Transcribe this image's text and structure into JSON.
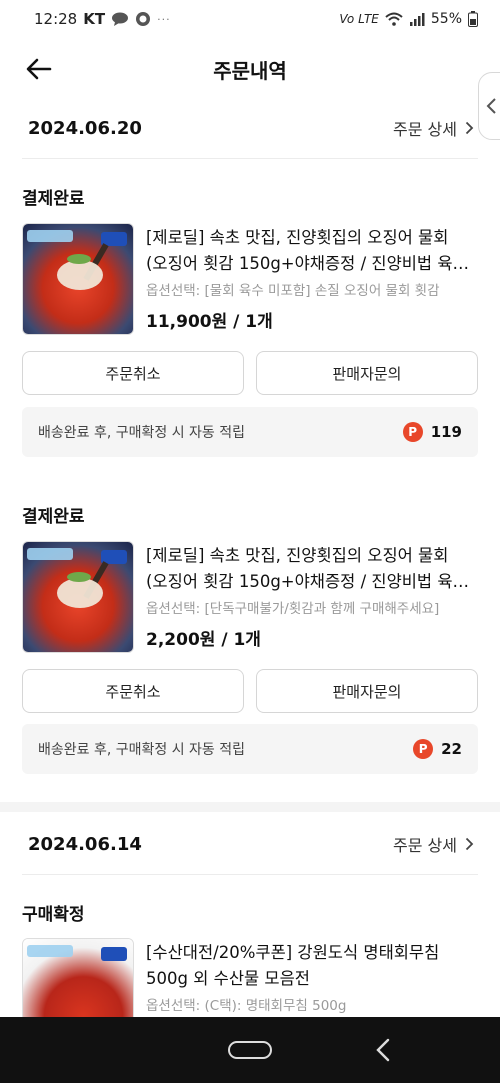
{
  "status_bar": {
    "time": "12:28",
    "carrier": "KT",
    "overflow": "···",
    "network": "Vo LTE",
    "battery": "55%"
  },
  "header": {
    "title": "주문내역"
  },
  "orders": [
    {
      "date": "2024.06.20",
      "detail_label": "주문 상세",
      "items": [
        {
          "status": "결제완료",
          "name": "[제로딜] 속초 맛집, 진양횟집의 오징어 물회(오징어 횟감 150g+야채증정 / 진양비법 육수 제공)",
          "option": "옵션선택: [물회 육수 미포함] 손질 오징어 물회 횟감",
          "price": "11,900원 / 1개",
          "cancel_label": "주문취소",
          "inquiry_label": "판매자문의",
          "point_msg": "배송완료 후, 구매확정 시 자동 적립",
          "point_icon": "P",
          "points": "119"
        },
        {
          "status": "결제완료",
          "name": "[제로딜] 속초 맛집, 진양횟집의 오징어 물회(오징어 횟감 150g+야채증정 / 진양비법 육수 제공)",
          "option": "옵션선택: [단독구매불가/횟감과 함께 구매해주세요]",
          "price": "2,200원 / 1개",
          "cancel_label": "주문취소",
          "inquiry_label": "판매자문의",
          "point_msg": "배송완료 후, 구매확정 시 자동 적립",
          "point_icon": "P",
          "points": "22"
        }
      ]
    },
    {
      "date": "2024.06.14",
      "detail_label": "주문 상세",
      "items": [
        {
          "status": "구매확정",
          "name": "[수산대전/20%쿠폰] 강원도식 명태회무침 500g 외 수산물 모음전",
          "option": "옵션선택: (C택): 명태회무침 500g"
        }
      ]
    }
  ],
  "colors": {
    "accent_point": "#e8472a",
    "text_muted": "#9a9a9a",
    "nav_bar": "#111111"
  },
  "icons": [
    "back-arrow-icon",
    "chevron-right-icon",
    "side-tab-chevron-icon",
    "point-icon",
    "wifi-icon",
    "signal-icon",
    "battery-icon",
    "home-pill-icon",
    "nav-back-icon"
  ]
}
